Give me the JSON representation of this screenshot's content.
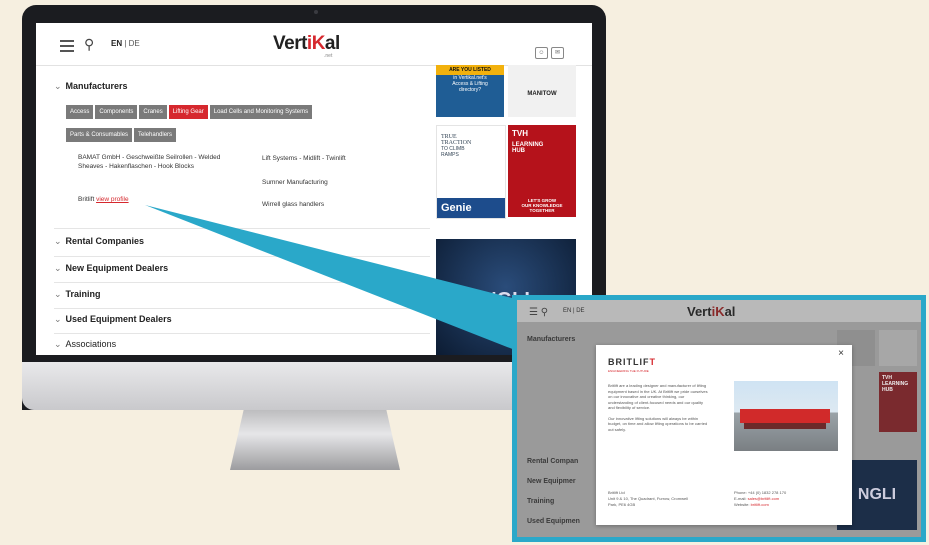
{
  "site": {
    "logo_text": "Vert",
    "logo_k": "iK",
    "logo_rest": "al",
    "logo_suffix": ".net",
    "lang_en": "EN",
    "lang_sep": " | ",
    "lang_de": "DE"
  },
  "directory": {
    "manufacturers_label": "Manufacturers",
    "tags": [
      {
        "label": "Access",
        "active": false
      },
      {
        "label": "Components",
        "active": false
      },
      {
        "label": "Cranes",
        "active": false
      },
      {
        "label": "Lifting Gear",
        "active": true
      },
      {
        "label": "Load Cells and Monitoring Systems",
        "active": false
      },
      {
        "label": "Parts & Consumables",
        "active": false
      },
      {
        "label": "Telehandlers",
        "active": false
      }
    ],
    "list_left": [
      "BAMAT GmbH - Geschweißte Seilrollen - Welded Sheaves - Hakenflaschen - Hook Blocks"
    ],
    "britlift_label": "Britlift",
    "view_profile_label": "view profile",
    "list_right": [
      "Lift Systems - Midlift - Twinlift",
      "Sumner Manufacturing",
      "Wirrell glass handlers"
    ],
    "sections": [
      "Rental Companies",
      "New Equipment Dealers",
      "Training",
      "Used Equipment Dealers",
      "Associations"
    ]
  },
  "ads": {
    "ad1_lines": [
      "ARE YOU LISTED",
      "in Vertikal.net's",
      "Access & Lifting",
      "directory?"
    ],
    "ad2_text": "MANITOW",
    "ad3_lines": [
      "TRUE",
      "TRACTION",
      "TO CLIMB",
      "RAMPS"
    ],
    "ad3_brand": "Genie",
    "ad4_lines": [
      "TVH",
      "LEARNING",
      "HUB",
      "LET'S GROW",
      "OUR KNOWLEDGE",
      "TOGETHER"
    ],
    "ad5_text": "NGLI"
  },
  "zoom": {
    "lang": "EN | DE",
    "sections": [
      "Manufacturers",
      "Rental Compan",
      "New Equipmer",
      "Training",
      "Used Equipmen"
    ],
    "right_ad_text": "NGLI",
    "right_ad_lines": [
      "TVH",
      "LEARNING",
      "HUB"
    ]
  },
  "modal": {
    "close": "×",
    "logo_main": "BRITLIF",
    "logo_t": "T",
    "tagline": "ENGINEERING THE FUTURE",
    "desc1": "Britlift are a leading designer and manufacturer of lifting equipment based in the UK. At Britlift we pride ourselves on our innovative and creative thinking, our understanding of client-focused needs and our quality and flexibility of service.",
    "desc2": "Our innovative lifting solutions will always be within budget, on time and allow lifting operations to be carried out safely.",
    "company": "Britlift Ltd",
    "address": "Unit 9 & 10, The Quadrant, Furrow, Cromwell Park, PE6 4GB",
    "phone_label": "Phone:",
    "phone": "+44 (0) 1832 278 170",
    "email_label": "E-mail:",
    "email": "sales@britlift.com",
    "website_label": "Website:",
    "website": "britlift.com"
  },
  "colors": {
    "accent_red": "#d6282e",
    "callout_blue": "#2aa8c9",
    "tag_grey": "#7a7a7a"
  }
}
